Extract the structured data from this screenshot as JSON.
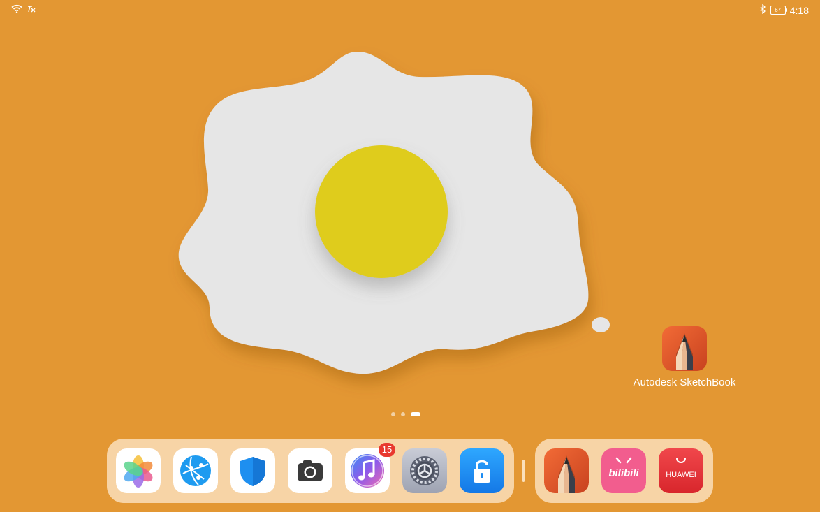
{
  "status_bar": {
    "time": "4:18",
    "battery_level": "67",
    "icons": [
      "wifi-icon",
      "data-transfer-icon",
      "bluetooth-icon",
      "battery-icon"
    ]
  },
  "wallpaper": {
    "description_icon": "fried-egg-wallpaper",
    "background_color": "#E39733",
    "white_color": "#E6E6E6",
    "yolk_color": "#DFCC1F"
  },
  "desktop": {
    "apps": [
      {
        "label": "Autodesk SketchBook",
        "icon": "sketchbook-icon"
      }
    ]
  },
  "page_indicator": {
    "pages": 3,
    "current": 3
  },
  "dock": {
    "apps": [
      {
        "icon": "gallery-icon"
      },
      {
        "icon": "browser-icon"
      },
      {
        "icon": "security-shield-icon"
      },
      {
        "icon": "camera-icon"
      },
      {
        "icon": "music-icon",
        "badge": "15"
      },
      {
        "icon": "settings-icon"
      },
      {
        "icon": "unlock-icon"
      }
    ],
    "recent_apps": [
      {
        "icon": "sketchbook-icon"
      },
      {
        "icon": "bilibili-icon",
        "label": "bilibili"
      },
      {
        "icon": "huawei-appgallery-icon",
        "label": "HUAWEI"
      }
    ]
  }
}
